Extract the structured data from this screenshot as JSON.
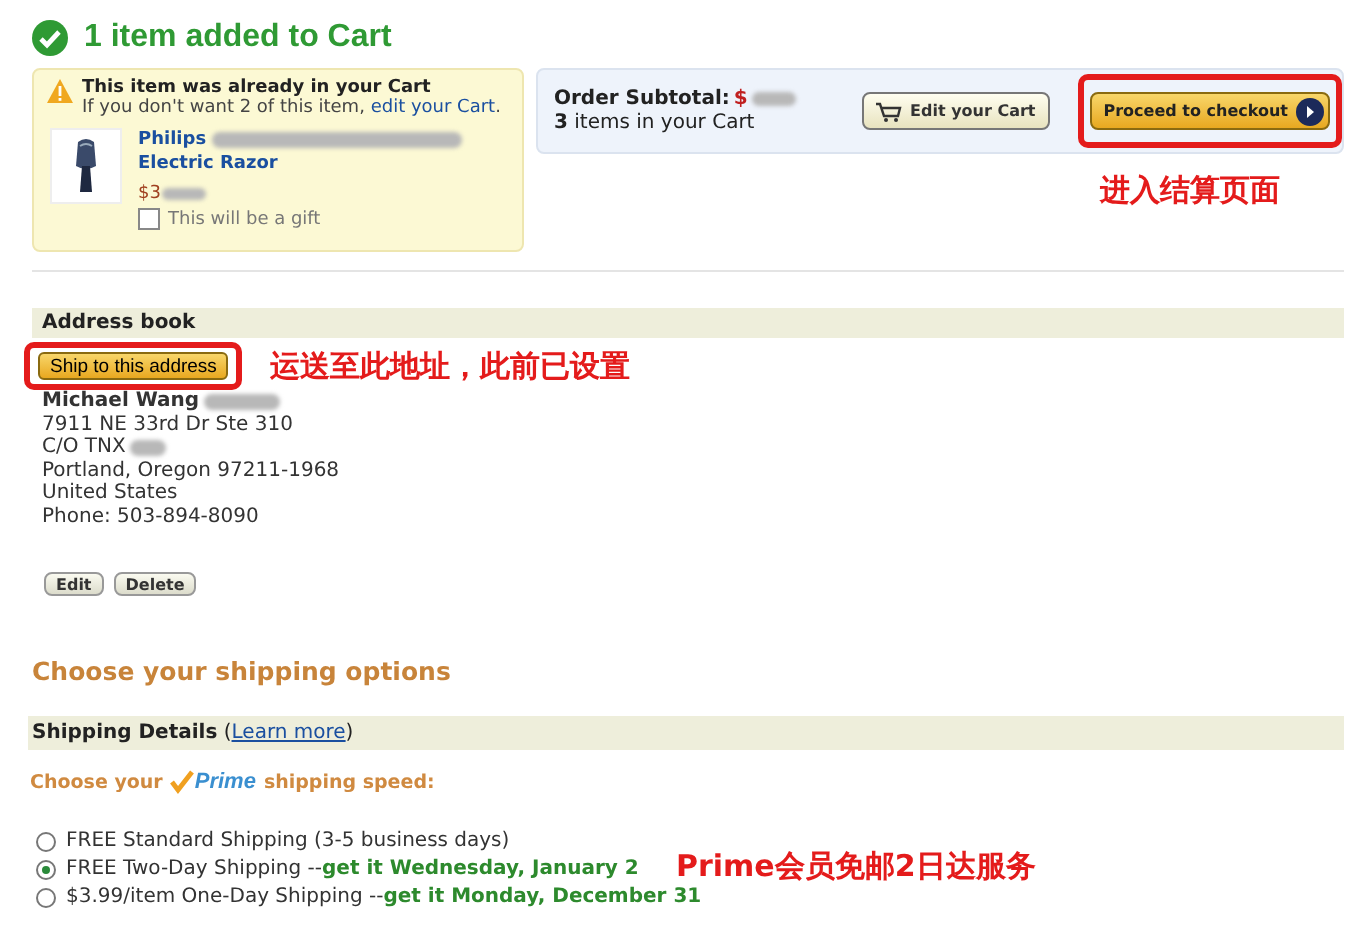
{
  "header": {
    "title": "1 item added to Cart"
  },
  "notice": {
    "title": "This item was already in your Cart",
    "text": "If you don't want 2 of this item, ",
    "link": "edit your Cart",
    "text_end": "."
  },
  "product": {
    "name_line1": "Philips",
    "name_line2": "Electric Razor",
    "price": "$3",
    "gift": {
      "label": "This will be a gift",
      "checked": false
    }
  },
  "summary": {
    "label": "Order Subtotal:",
    "amount": "$",
    "count": "**3** items in your Cart"
  },
  "cart_buttons": [
    {
      "label": "Edit your Cart",
      "kind": "cart"
    },
    {
      "label": "Proceed to checkout",
      "kind": "checkout",
      "highlighted": true
    }
  ],
  "annotations": [
    {
      "text": "进入结算页面"
    },
    {
      "text": "运送至此地址，此前已设置"
    },
    {
      "text": "Prime会员免邮2日达服务"
    }
  ],
  "address_book": {
    "title": "Address book",
    "ship_button": {
      "label": "Ship to this address",
      "highlighted": true
    },
    "lines": [
      {
        "text": "Michael Wang",
        "kind": "name"
      },
      {
        "text": "7911 NE 33rd Dr Ste 310",
        "kind": "line"
      },
      {
        "text": "C/O TNX",
        "kind": "redacted"
      },
      {
        "text": "Portland, Oregon 97211-1968",
        "kind": "line"
      },
      {
        "text": "United States",
        "kind": "line"
      },
      {
        "text": "Phone: 503-894-8090",
        "kind": "line"
      }
    ],
    "actions": [
      "Edit",
      "Delete"
    ]
  },
  "shipping": {
    "heading": "Choose your shipping options",
    "details_title": "Shipping Details",
    "open_paren": "(",
    "learn_more": "Learn more",
    "close_paren": ")",
    "prime_before": "Choose your",
    "prime_logo": "Prime",
    "prime_after": "shipping speed:",
    "options": [
      {
        "label": "FREE Standard Shipping (3-5 business days)",
        "selected": false
      },
      {
        "label": "FREE Two-Day Shipping --",
        "delivery": "get it Wednesday, January 2",
        "selected": true
      },
      {
        "label": "$3.99/item One-Day Shipping --",
        "delivery": "get it Monday, December 31",
        "selected": false
      }
    ]
  }
}
